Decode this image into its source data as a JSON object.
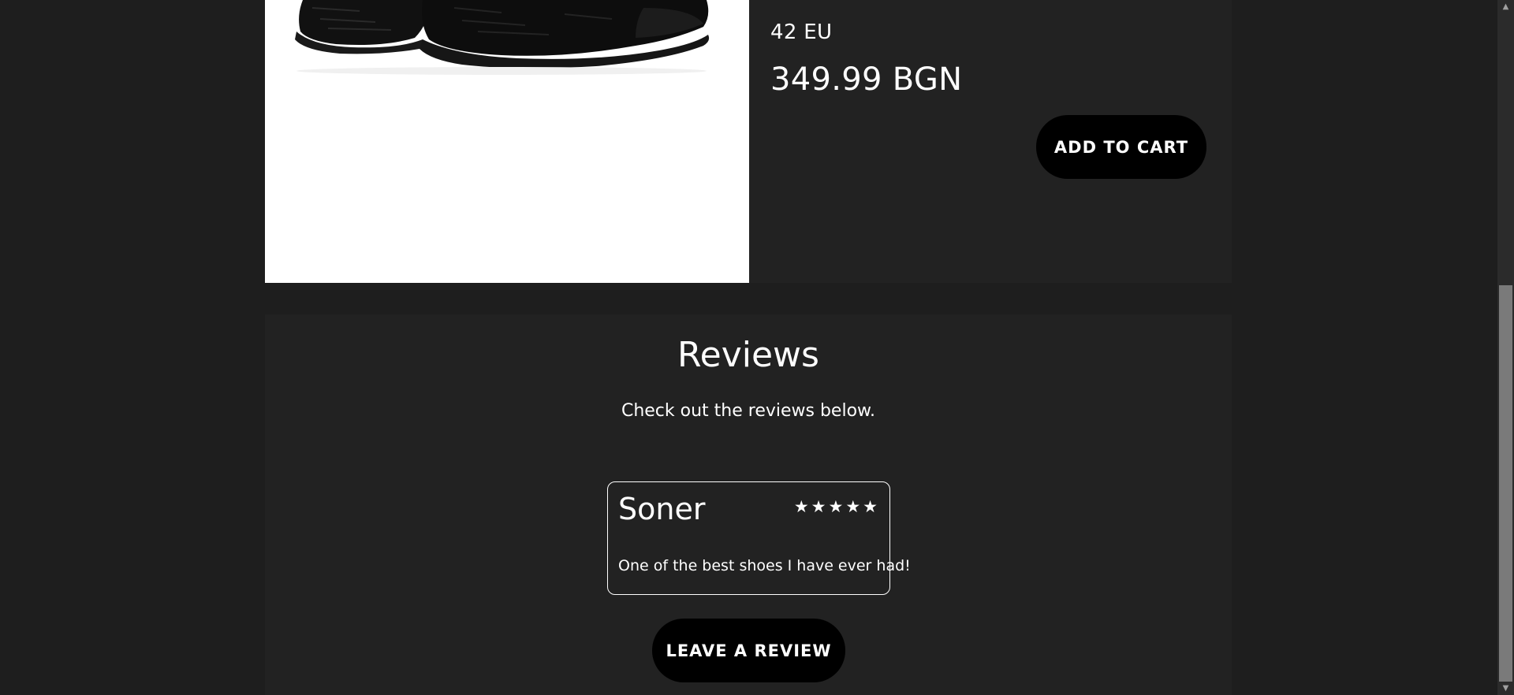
{
  "product": {
    "size": "42 EU",
    "price": "349.99 BGN",
    "add_to_cart_label": "ADD TO CART"
  },
  "reviews": {
    "title": "Reviews",
    "subtitle": "Check out the reviews below.",
    "items": [
      {
        "name": "Soner",
        "rating": 5,
        "stars": "★★★★★",
        "text": "One of the best shoes I have ever had!"
      }
    ],
    "leave_review_label": "LEAVE A REVIEW"
  },
  "colors": {
    "page_background": "#1e1e1e",
    "panel_background": "#222222",
    "button_background": "#000000",
    "text": "#ffffff"
  },
  "icons": {
    "scroll_up": "scroll-up-arrow-icon",
    "scroll_down": "scroll-down-arrow-icon"
  }
}
